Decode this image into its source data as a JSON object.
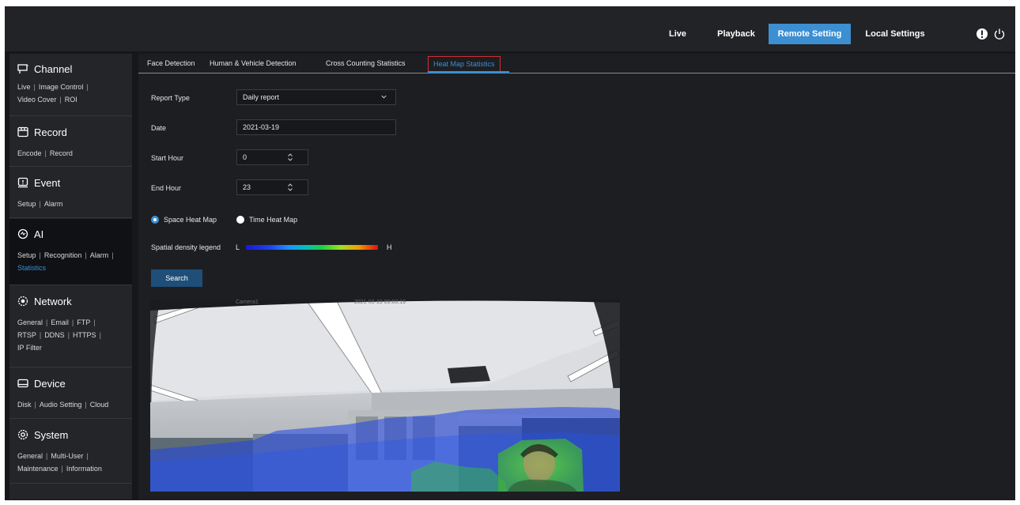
{
  "topnav": {
    "items": [
      {
        "label": "Live",
        "active": false
      },
      {
        "label": "Playback",
        "active": false
      },
      {
        "label": "Remote Setting",
        "active": true
      },
      {
        "label": "Local Settings",
        "active": false
      }
    ],
    "icons": [
      "info-icon",
      "power-icon"
    ],
    "accent": "#3c8fd1"
  },
  "sidebar": {
    "sections": [
      {
        "title": "Channel",
        "icon": "channel-icon",
        "links": [
          [
            "Live",
            "Image Control"
          ],
          [
            "Video Cover",
            "ROI"
          ]
        ]
      },
      {
        "title": "Record",
        "icon": "record-icon",
        "links": [
          [
            "Encode",
            "Record"
          ]
        ]
      },
      {
        "title": "Event",
        "icon": "event-icon",
        "links": [
          [
            "Setup",
            "Alarm"
          ]
        ]
      },
      {
        "title": "AI",
        "icon": "ai-icon",
        "active": true,
        "links": [
          [
            "Setup",
            "Recognition",
            "Alarm"
          ],
          [
            "Statistics"
          ]
        ],
        "selected": "Statistics"
      },
      {
        "title": "Network",
        "icon": "network-icon",
        "links": [
          [
            "General",
            "Email",
            "FTP"
          ],
          [
            "RTSP",
            "DDNS",
            "HTTPS"
          ],
          [
            "IP Filter"
          ]
        ]
      },
      {
        "title": "Device",
        "icon": "device-icon",
        "links": [
          [
            "Disk",
            "Audio Setting",
            "Cloud"
          ]
        ]
      },
      {
        "title": "System",
        "icon": "system-icon",
        "links": [
          [
            "General",
            "Multi-User"
          ],
          [
            "Maintenance",
            "Information"
          ]
        ]
      }
    ]
  },
  "tabs": [
    "Face Detection",
    "Human & Vehicle Detection",
    "Cross Counting Statistics",
    "Heat Map Statistics"
  ],
  "active_tab": "Heat Map Statistics",
  "form": {
    "report_type_label": "Report Type",
    "report_type_value": "Daily report",
    "date_label": "Date",
    "date_value": "2021-03-19",
    "start_hour_label": "Start Hour",
    "start_hour_value": "0",
    "end_hour_label": "End Hour",
    "end_hour_value": "23",
    "space_heat_map": "Space Heat Map",
    "time_heat_map": "Time Heat Map",
    "selected_mode": "Space Heat Map",
    "legend_label": "Spatial density legend",
    "legend_low": "L",
    "legend_high": "H",
    "search_label": "Search"
  },
  "image": {
    "overlay_camera": "Camera1",
    "overlay_time": "2021-03-19 09:03:19"
  }
}
